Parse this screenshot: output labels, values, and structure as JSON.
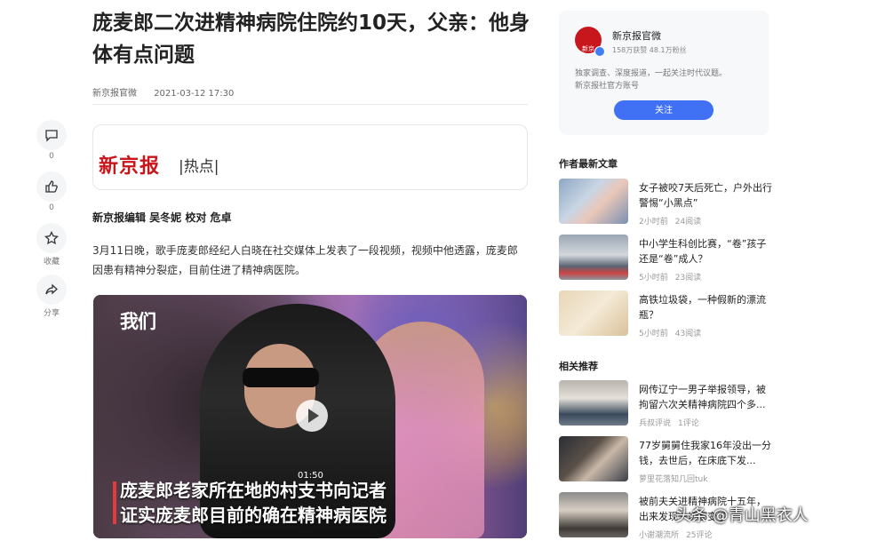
{
  "article": {
    "title": "庞麦郎二次进精神病院住院约10天，父亲：他身体有点问题",
    "source": "新京报官微",
    "date": "2021-03-12 17:30",
    "banner_logo": "新京报",
    "banner_tag": "|热点|",
    "editor_line": "新京报编辑 吴冬妮 校对 危卓",
    "paragraph": "3月11日晚，歌手庞麦郎经纪人白晓在社交媒体上发表了一段视频，视频中他透露，庞麦郎因患有精神分裂症，目前住进了精神病医院。"
  },
  "rail": {
    "comment_count": "0",
    "like_count": "0",
    "favorite_label": "收藏",
    "share_label": "分享"
  },
  "video": {
    "logo": "我们",
    "duration": "01:50",
    "caption_line1": "庞麦郎老家所在地的村支书向记者",
    "caption_line2": "证实庞麦郎目前的确在精神病医院"
  },
  "author_card": {
    "name": "新京报官微",
    "avatar_text": "新京",
    "stats": "158万获赞 48.1万粉丝",
    "desc_line1": "独家调查、深度报道，一起关注时代议题。",
    "desc_line2": "新京报社官方账号",
    "follow_label": "关注"
  },
  "latest": {
    "heading": "作者最新文章",
    "items": [
      {
        "title": "女子被咬7天后死亡，户外出行警惕“小黑点”",
        "time": "2小时前",
        "reads": "24阅读"
      },
      {
        "title": "中小学生科创比赛，“卷”孩子还是“卷”成人？",
        "time": "5小时前",
        "reads": "23阅读"
      },
      {
        "title": "高铁垃圾袋，一种假新的漂流瓶？",
        "time": "5小时前",
        "reads": "43阅读"
      }
    ]
  },
  "related": {
    "heading": "相关推荐",
    "items": [
      {
        "title": "网传辽宁一男子举报领导，被拘留六次关精神病院四个多...",
        "source": "兵叔评说",
        "comments": "1评论"
      },
      {
        "title": "77岁舅舅住我家16年没出一分钱，去世后，在床底下发...",
        "source": "萝里花落知几回tuk",
        "comments": ""
      },
      {
        "title": "被前夫关进精神病院十五年，出来发现一切都变了",
        "source": "小谢潮流所",
        "comments": "25评论"
      }
    ]
  },
  "watermark": "头条 @青山黑衣人"
}
